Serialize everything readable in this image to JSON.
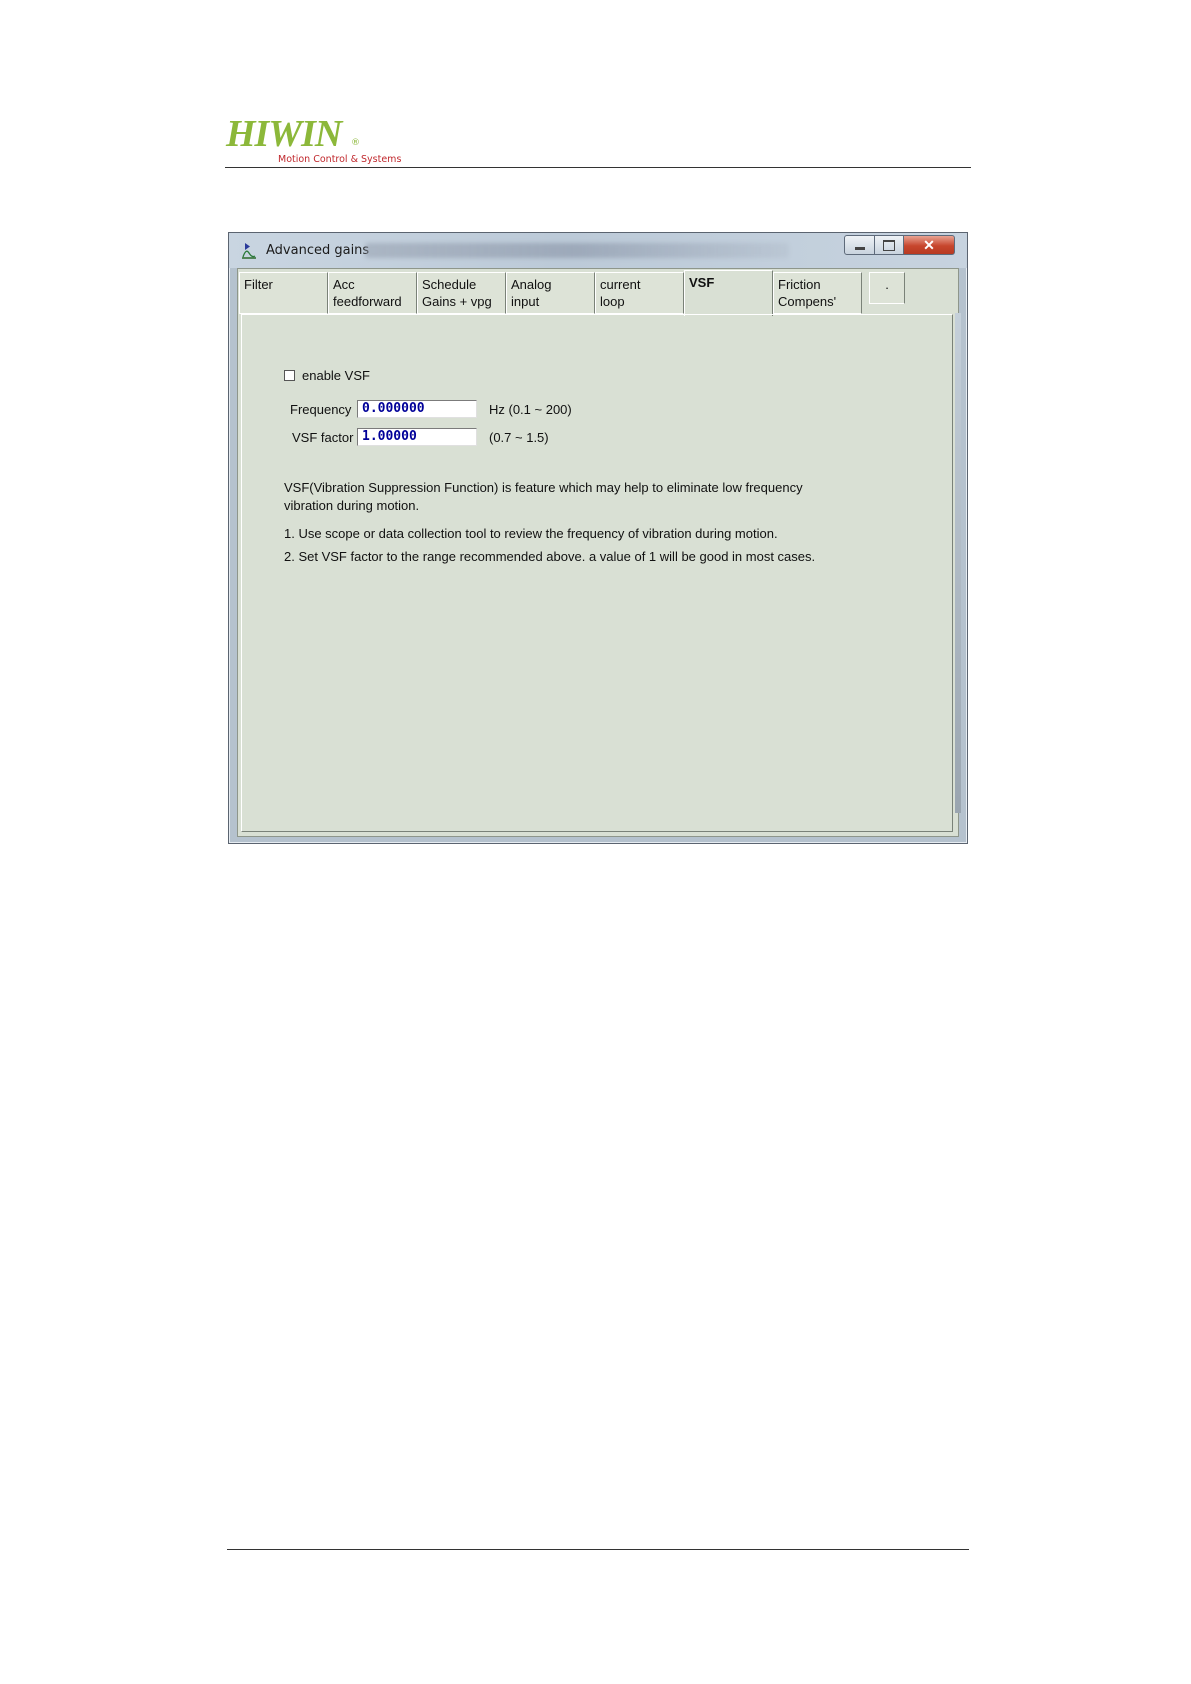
{
  "brand": {
    "name": "HIWIN",
    "reg": "®",
    "tagline": "Motion Control & Systems"
  },
  "window": {
    "title": "Advanced gains",
    "close_glyph": "✕"
  },
  "tabs": [
    {
      "line1": "Filter",
      "line2": ""
    },
    {
      "line1": "Acc",
      "line2": "feedforward"
    },
    {
      "line1": "Schedule",
      "line2": "Gains + vpg"
    },
    {
      "line1": "Analog",
      "line2": "input"
    },
    {
      "line1": "current",
      "line2": "loop"
    },
    {
      "line1": "VSF",
      "line2": ""
    },
    {
      "line1": "Friction",
      "line2": "Compens'"
    },
    {
      "line1": ".",
      "line2": ""
    }
  ],
  "vsf": {
    "enable_label": "enable VSF",
    "enabled": false,
    "frequency_label": "Frequency",
    "frequency_value": "0.000000",
    "frequency_range": "Hz (0.1 ~ 200)",
    "factor_label": "VSF factor",
    "factor_value": "1.00000",
    "factor_range": "(0.7 ~ 1.5)",
    "description": "VSF(Vibration Suppression Function) is feature which may help to eliminate low frequency vibration during motion.",
    "note1": "1. Use scope or data collection tool to review the frequency of vibration during motion.",
    "note2": "2. Set VSF factor to the range recommended above. a value of 1 will be good in most cases."
  }
}
